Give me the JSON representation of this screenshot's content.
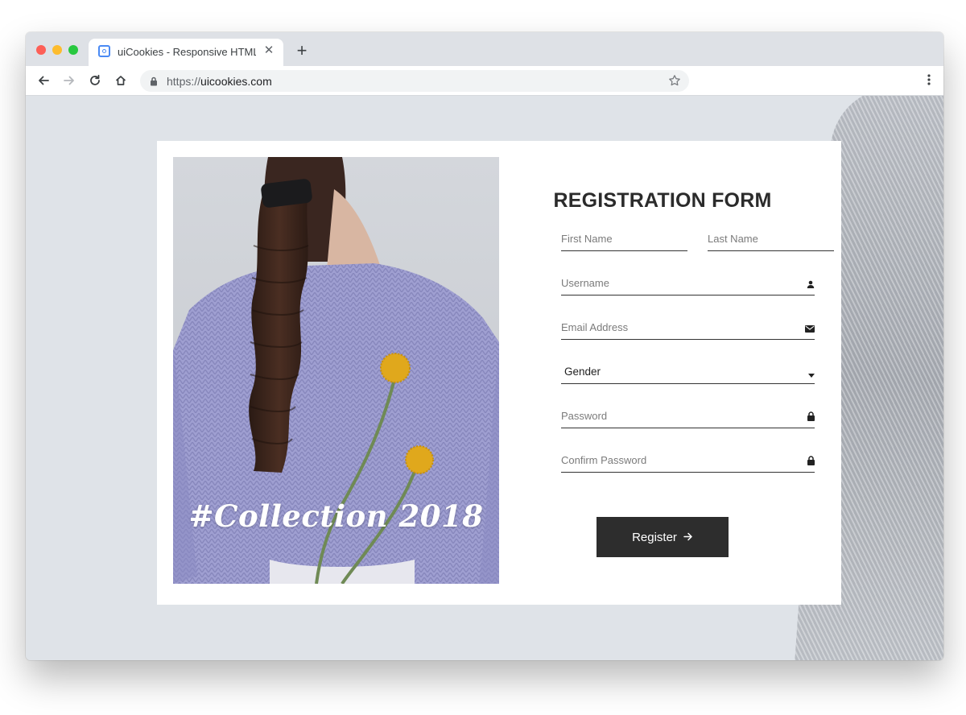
{
  "browser": {
    "tab_title": "uiCookies - Responsive HTML",
    "tab_close": "✕",
    "new_tab": "+",
    "url_scheme": "https://",
    "url_host": "uicookies.com"
  },
  "hero": {
    "caption": "#Collection 2018"
  },
  "form": {
    "title": "REGISTRATION FORM",
    "first_name_placeholder": "First Name",
    "last_name_placeholder": "Last Name",
    "username_placeholder": "Username",
    "email_placeholder": "Email Address",
    "gender_value": "Gender",
    "password_placeholder": "Password",
    "confirm_password_placeholder": "Confirm Password",
    "register_label": "Register"
  },
  "icons": {
    "username": "user-icon",
    "email": "envelope-icon",
    "gender": "caret-down-icon",
    "password": "lock-icon",
    "confirm_password": "lock-icon",
    "register": "arrow-right-icon"
  },
  "colors": {
    "page_bg": "#dfe3e8",
    "card_bg": "#ffffff",
    "button_bg": "#2d2d2d",
    "title_text": "#2b2b2b"
  }
}
